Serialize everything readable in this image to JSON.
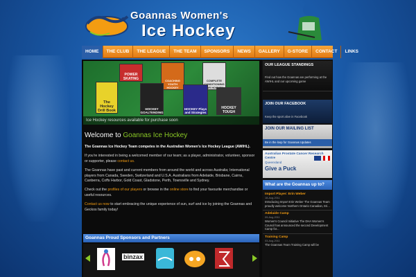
{
  "header": {
    "title_line1": "Goannas Women's",
    "title_line2": "Ice Hockey"
  },
  "nav": {
    "items": [
      "HOME",
      "THE CLUB",
      "THE LEAGUE",
      "THE TEAM",
      "SPONSORS",
      "NEWS",
      "GALLERY",
      "G-STORE",
      "CONTACT",
      "LINKS"
    ],
    "active": "HOME"
  },
  "banner": {
    "caption": "Ice Hockey resources available for purchase soon",
    "books": [
      "POWER SKATING",
      "COACHING YOUTH HOCKEY",
      "COMPLETE CONDITIONING FOR HOCKEY",
      "The Hockey Drill Book",
      "HOCKEY GOALTENDING",
      "HOCKEY Plays and Strategies",
      "HOCKEY TOUGH"
    ]
  },
  "welcome": {
    "heading_prefix": "Welcome to",
    "heading_highlight": "Goannas Ice Hockey",
    "intro": "The Goannas Ice Hockey Team competes in the Australian Women's Ice Hockey League (AWIHL).",
    "p2_text": "If you're interested in being a welcomed member of our team; as a player, administrator, volunteer, sponsor or supporter, please",
    "p2_link": "contact us.",
    "p3": "The Goannas have past and current members from around the world and across Australia; International players from Canada, Sweden, Switzerland and U.S.A. Australians from Adelaide, Brisbane, Cairns, Canberra, Coffs Harbor, Gold Coast, Gladstone, Perth, Townsville and Sydney.",
    "p4_pre": "Check out the",
    "p4_link1": "profiles of our players",
    "p4_mid": "or browse in the",
    "p4_link2": "online store",
    "p4_post": "to find your favourite merchandise or useful resources.",
    "p5_link": "Contact us now",
    "p5_text": "to start embracing the unique experience of sun, surf and ice by joining the Goannas and Geckos family today!"
  },
  "sponsors": {
    "heading": "Goannas Proud Sponsors and Partners",
    "logos": [
      "binzax"
    ]
  },
  "sidebar": {
    "standings_title": "OUR LEAGUE STANDINGS",
    "standings_caption": "Find out how the Goannas are performing at the AWIHL and our upcoming game",
    "facebook_title": "JOIN OUR FACEBOOK",
    "facebook_caption": "Keep the sport alive in Facebook",
    "mailing_title": "JOIN OUR MAILING LIST",
    "mailing_caption": "Be in the loop for Goannas Updates",
    "prostate_title": "Australian Prostate Cancer Research Centre",
    "prostate_state": "Queensland",
    "prostate_puck": "Give a Puck",
    "upto_heading": "What are the Goannas up to?",
    "news": [
      {
        "title": "Import Player: Erin Weber",
        "date": "18-Aug-2011",
        "text": "Introducing Import Erin Weber The Goannas Team proudly welcome Northern Ontario Canadian, Eri..."
      },
      {
        "title": "Adelaide Camp",
        "date": "09-Aug-2011",
        "text": "Women's Council Initiative The DHA Women's Council has announced the second Development Camp for..."
      },
      {
        "title": "Training Camp",
        "date": "03-Aug-2011",
        "text": "The Goannas Team Training Camp will be"
      }
    ]
  },
  "colors": {
    "nav_orange": "#e27a13",
    "accent_blue": "#2a5ea8",
    "link_orange": "#f39c12",
    "highlight_green": "#8ac926"
  }
}
